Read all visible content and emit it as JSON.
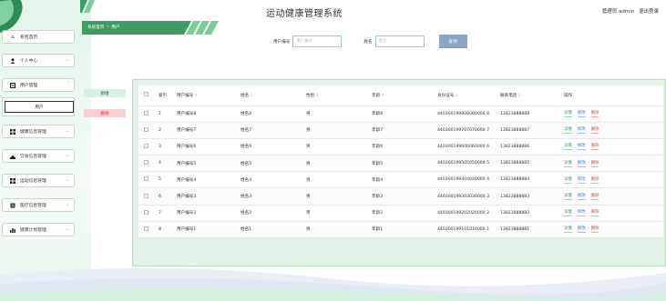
{
  "header": {
    "site_title": "运动健康管理系统",
    "user_label": "管理员 admin",
    "logout_label": "退出登录"
  },
  "breadcrumb": {
    "home": "系统首页",
    "separator": "›",
    "current": "用户"
  },
  "sidebar": {
    "items": [
      {
        "label": "系统首页",
        "icon": "home-icon",
        "expandable": false
      },
      {
        "label": "个人中心",
        "icon": "person-icon",
        "expandable": true
      },
      {
        "label": "用户管理",
        "icon": "list-icon",
        "expandable": true,
        "expanded": true
      },
      {
        "label": "健康信息管理",
        "icon": "grid-icon",
        "expandable": true
      },
      {
        "label": "饮食信息管理",
        "icon": "grid-icon",
        "expandable": true
      },
      {
        "label": "运动信息管理",
        "icon": "grid-icon",
        "expandable": true
      },
      {
        "label": "医疗信息管理",
        "icon": "list-icon",
        "expandable": true
      },
      {
        "label": "健康计划管理",
        "icon": "chart-icon",
        "expandable": true
      }
    ],
    "submenu": {
      "active": "用户"
    }
  },
  "search": {
    "code_label": "用户编号",
    "code_placeholder": "用户编号",
    "name_label": "姓名",
    "name_placeholder": "姓名",
    "button": "查询"
  },
  "actions": {
    "add": "新增",
    "delete": "删除"
  },
  "table": {
    "headers": {
      "index": "索引",
      "code": "用户编号",
      "name": "姓名",
      "gender": "性别",
      "age": "年龄",
      "id_card": "身份证号",
      "phone": "联系电话",
      "ops": "操作"
    },
    "op_labels": {
      "detail": "详情",
      "edit": "修改",
      "delete": "删除"
    },
    "rows": [
      {
        "index": "1",
        "code": "用户编号8",
        "name": "姓名8",
        "gender": "男",
        "age": "年龄8",
        "id_card": "440300199808080000 8",
        "phone": "13823888888"
      },
      {
        "index": "2",
        "code": "用户编号7",
        "name": "姓名7",
        "gender": "男",
        "age": "年龄7",
        "id_card": "440300199707070000 7",
        "phone": "13823888887"
      },
      {
        "index": "3",
        "code": "用户编号6",
        "name": "姓名6",
        "gender": "男",
        "age": "年龄6",
        "id_card": "440300199606060000 6",
        "phone": "13823888886"
      },
      {
        "index": "4",
        "code": "用户编号5",
        "name": "姓名5",
        "gender": "男",
        "age": "年龄5",
        "id_card": "440300199505050000 5",
        "phone": "13823888885"
      },
      {
        "index": "5",
        "code": "用户编号4",
        "name": "姓名4",
        "gender": "男",
        "age": "年龄4",
        "id_card": "440300199404040000 4",
        "phone": "13823888884"
      },
      {
        "index": "6",
        "code": "用户编号3",
        "name": "姓名3",
        "gender": "男",
        "age": "年龄3",
        "id_card": "440300199303030000 3",
        "phone": "13823888883"
      },
      {
        "index": "7",
        "code": "用户编号2",
        "name": "姓名2",
        "gender": "男",
        "age": "年龄2",
        "id_card": "440300199202020000 2",
        "phone": "13823888882"
      },
      {
        "index": "8",
        "code": "用户编号1",
        "name": "姓名1",
        "gender": "男",
        "age": "年龄1",
        "id_card": "440300199101010000 1",
        "phone": "13823888881"
      }
    ]
  },
  "colors": {
    "accent_green": "#3cb371",
    "search_button": "#8aa4c2",
    "delete_red": "#d04848",
    "edit_blue": "#4a73c8"
  }
}
